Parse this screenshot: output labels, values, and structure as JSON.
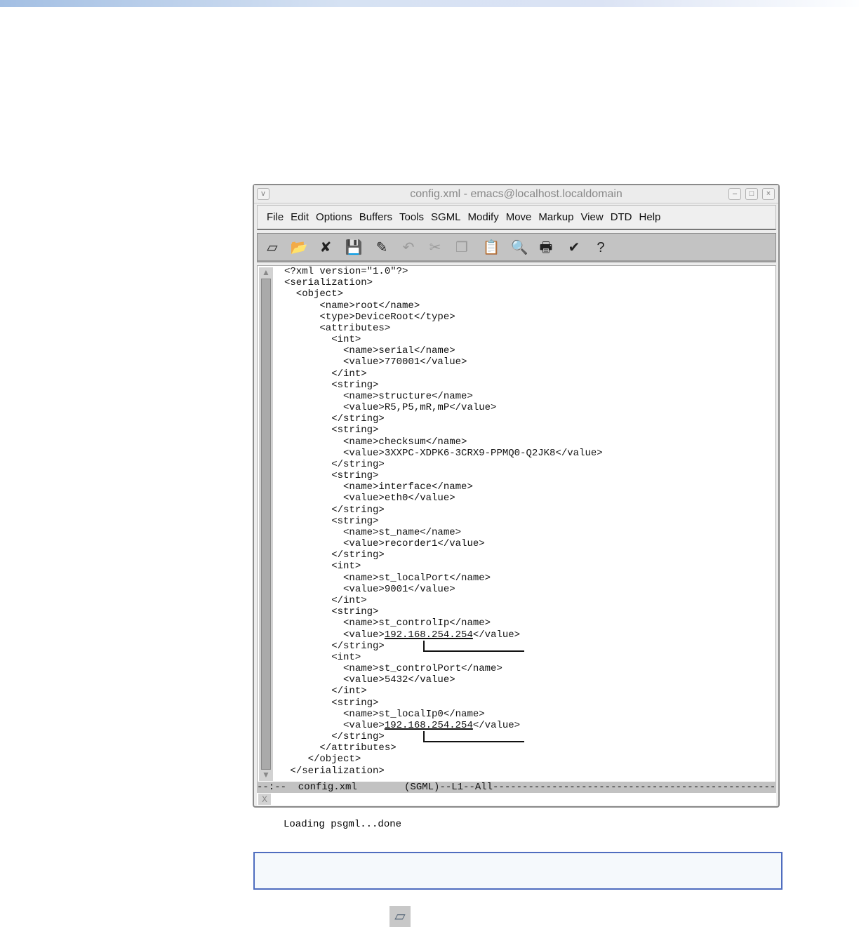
{
  "window": {
    "title": "config.xml - emacs@localhost.localdomain",
    "collapse_icon": "v",
    "minimize": "–",
    "maximize": "□",
    "close": "×"
  },
  "menu": [
    "File",
    "Edit",
    "Options",
    "Buffers",
    "Tools",
    "SGML",
    "Modify",
    "Move",
    "Markup",
    "View",
    "DTD",
    "Help"
  ],
  "toolbar": [
    {
      "name": "new-file-icon",
      "glyph": "▱",
      "dim": false
    },
    {
      "name": "open-folder-icon",
      "glyph": "📂",
      "dim": false
    },
    {
      "name": "close-buffer-icon",
      "glyph": "✘",
      "dim": false
    },
    {
      "name": "save-icon",
      "glyph": "💾",
      "dim": true
    },
    {
      "name": "save-as-icon",
      "glyph": "✎",
      "dim": false
    },
    {
      "name": "undo-icon",
      "glyph": "↶",
      "dim": true
    },
    {
      "name": "cut-icon",
      "glyph": "✂",
      "dim": true
    },
    {
      "name": "copy-icon",
      "glyph": "❐",
      "dim": true
    },
    {
      "name": "paste-icon",
      "glyph": "📋",
      "dim": true
    },
    {
      "name": "search-icon",
      "glyph": "🔍",
      "dim": false
    },
    {
      "name": "print-icon",
      "glyph": "🖶",
      "dim": false
    },
    {
      "name": "customize-icon",
      "glyph": "✔",
      "dim": false
    },
    {
      "name": "help-icon",
      "glyph": "?",
      "dim": false
    }
  ],
  "code": [
    {
      "t": "<?xml version=\"1.0\"?>"
    },
    {
      "t": "<serialization>"
    },
    {
      "t": "  <object>"
    },
    {
      "t": "      <name>root</name>"
    },
    {
      "t": "      <type>DeviceRoot</type>"
    },
    {
      "t": "      <attributes>"
    },
    {
      "t": "        <int>"
    },
    {
      "t": "          <name>serial</name>"
    },
    {
      "t": "          <value>770001</value>"
    },
    {
      "t": "        </int>"
    },
    {
      "t": "        <string>"
    },
    {
      "t": "          <name>structure</name>"
    },
    {
      "t": "          <value>R5,P5,mR,mP</value>"
    },
    {
      "t": "        </string>"
    },
    {
      "t": "        <string>"
    },
    {
      "t": "          <name>checksum</name>"
    },
    {
      "t": "          <value>3XXPC-XDPK6-3CRX9-PPMQ0-Q2JK8</value>"
    },
    {
      "t": "        </string>"
    },
    {
      "t": "        <string>"
    },
    {
      "t": "          <name>interface</name>"
    },
    {
      "t": "          <value>eth0</value>"
    },
    {
      "t": "        </string>"
    },
    {
      "t": "        <string>"
    },
    {
      "t": "          <name>st_name</name>"
    },
    {
      "t": "          <value>recorder1</value>"
    },
    {
      "t": "        </string>"
    },
    {
      "t": "        <int>"
    },
    {
      "t": "          <name>st_localPort</name>"
    },
    {
      "t": "          <value>9001</value>"
    },
    {
      "t": "        </int>"
    },
    {
      "t": "        <string>"
    },
    {
      "t": "          <name>st_controlIp</name>"
    },
    {
      "t": "          <value>",
      "u": "192.168.254.254",
      "p": "</value>"
    },
    {
      "t": "        </string>"
    },
    {
      "t": "        <int>"
    },
    {
      "t": "          <name>st_controlPort</name>"
    },
    {
      "t": "          <value>5432</value>"
    },
    {
      "t": "        </int>"
    },
    {
      "t": "        <string>"
    },
    {
      "t": "          <name>st_localIp0</name>"
    },
    {
      "t": "          <value>",
      "u": "192.168.254.254",
      "p": "</value>"
    },
    {
      "t": "        </string>"
    },
    {
      "t": "      </attributes>"
    },
    {
      "t": "    </object>"
    },
    {
      "t": " </serialization>"
    }
  ],
  "modeline": "--:--  config.xml        (SGML)--L1--All-----------------------------------------------------",
  "modeline_file": "config.xml",
  "minibuffer": "Loading psgml...done"
}
